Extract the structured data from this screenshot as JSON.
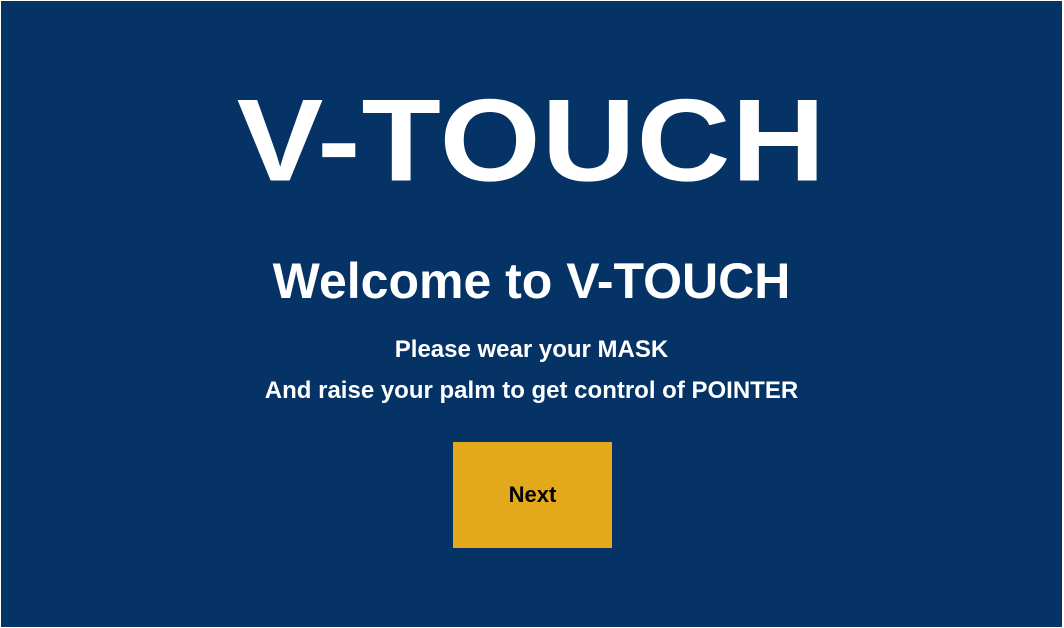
{
  "app": {
    "logo_text": "V-TOUCH",
    "welcome_text": "Welcome to V-TOUCH",
    "instructions": [
      "Please wear your MASK",
      "And raise your palm to get control of POINTER"
    ],
    "next_button_label": "Next"
  },
  "colors": {
    "background": "#053366",
    "text": "#ffffff",
    "button_background": "#e4a81b",
    "button_text": "#000000"
  }
}
